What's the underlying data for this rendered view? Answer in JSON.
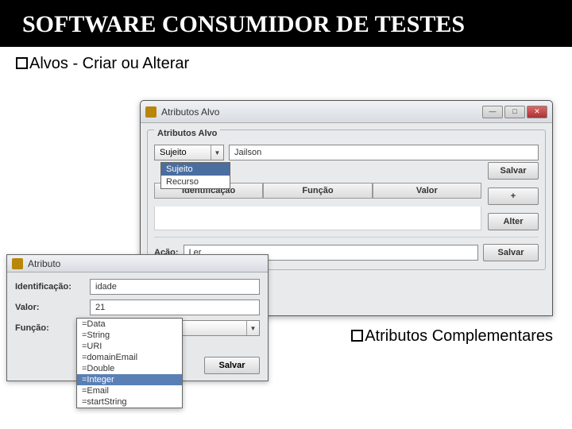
{
  "slide": {
    "title": "SOFTWARE CONSUMIDOR DE TESTES",
    "bullet1": "Alvos - Criar ou Alterar",
    "bullet2": "Atributos Complementares"
  },
  "win1": {
    "title": "Atributos Alvo",
    "group_title": "Atributos Alvo",
    "subject_combo": "Sujeito",
    "subject_value": "Jailson",
    "dropdown": {
      "sujeito": "Sujeito",
      "recurso": "Recurso"
    },
    "table_headers": {
      "id": "Identificação",
      "funcao": "Função",
      "valor": "Valor"
    },
    "buttons": {
      "salvar": "Salvar",
      "plus": "+",
      "alter": "Alter"
    },
    "acao_label": "Ação:",
    "acao_value": "Ler",
    "acao_save": "Salvar"
  },
  "win2": {
    "title": "Atributo",
    "id_label": "Identificação:",
    "id_value": "idade",
    "valor_label": "Valor:",
    "valor_value": "21",
    "funcao_label": "Função:",
    "funcao_value": "=Integer",
    "save": "Salvar",
    "options": {
      "data": "=Data",
      "string": "=String",
      "uri": "=URI",
      "email": "=domainEmail",
      "double": "=Double",
      "integer": "=Integer",
      "email2": "=Email",
      "startstring": "=startString"
    }
  }
}
